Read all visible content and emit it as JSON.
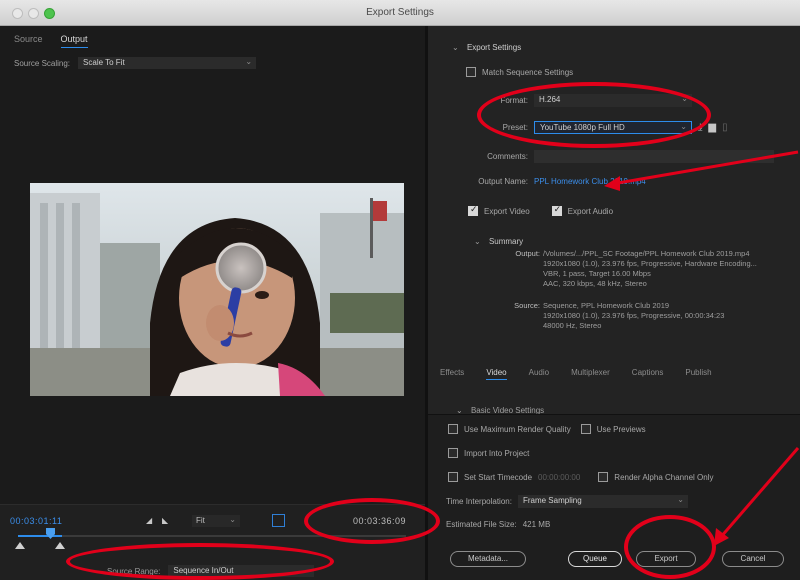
{
  "window": {
    "title": "Export Settings"
  },
  "left": {
    "tabs": [
      {
        "label": "Source",
        "active": false
      },
      {
        "label": "Output",
        "active": true
      }
    ],
    "source_scaling_label": "Source Scaling:",
    "source_scaling_value": "Scale To Fit",
    "timecode_in": "00:03:01:11",
    "timecode_out": "00:03:36:09",
    "fit_value": "Fit",
    "source_range_label": "Source Range:",
    "source_range_value": "Sequence In/Out"
  },
  "export": {
    "section_title": "Export Settings",
    "match_sequence_label": "Match Sequence Settings",
    "match_sequence_checked": false,
    "format_label": "Format:",
    "format_value": "H.264",
    "preset_label": "Preset:",
    "preset_value": "YouTube 1080p Full HD",
    "comments_label": "Comments:",
    "comments_value": "",
    "output_name_label": "Output Name:",
    "output_name_value": "PPL Homework Club 2019.mp4",
    "export_video_label": "Export Video",
    "export_video_checked": true,
    "export_audio_label": "Export Audio",
    "export_audio_checked": true,
    "summary_title": "Summary",
    "summary_output_key": "Output:",
    "summary_output_lines": [
      "/Volumes/.../PPL_SC Footage/PPL Homework Club 2019.mp4",
      "1920x1080 (1.0), 23.976 fps, Progressive, Hardware Encoding...",
      "VBR, 1 pass, Target 16.00 Mbps",
      "AAC, 320 kbps, 48 kHz, Stereo"
    ],
    "summary_source_key": "Source:",
    "summary_source_lines": [
      "Sequence, PPL Homework Club 2019",
      "1920x1080 (1.0), 23.976 fps, Progressive, 00:00:34:23",
      "48000 Hz, Stereo"
    ]
  },
  "settings_tabs": [
    {
      "label": "Effects",
      "active": false
    },
    {
      "label": "Video",
      "active": true
    },
    {
      "label": "Audio",
      "active": false
    },
    {
      "label": "Multiplexer",
      "active": false
    },
    {
      "label": "Captions",
      "active": false
    },
    {
      "label": "Publish",
      "active": false
    }
  ],
  "basic_video_settings": "Basic Video Settings",
  "options": {
    "max_render_quality": "Use Maximum Render Quality",
    "use_previews": "Use Previews",
    "import_into_project": "Import Into Project",
    "set_start_timecode": "Set Start Timecode",
    "start_timecode_value": "00:00:00:00",
    "render_alpha_only": "Render Alpha Channel Only",
    "time_interpolation_label": "Time Interpolation:",
    "time_interpolation_value": "Frame Sampling",
    "estimated_file_size_label": "Estimated File Size:",
    "estimated_file_size_value": "421 MB"
  },
  "buttons": {
    "metadata": "Metadata...",
    "queue": "Queue",
    "export": "Export",
    "cancel": "Cancel"
  },
  "colors": {
    "accent": "#2d8ceb",
    "annotation": "#e2001a"
  }
}
